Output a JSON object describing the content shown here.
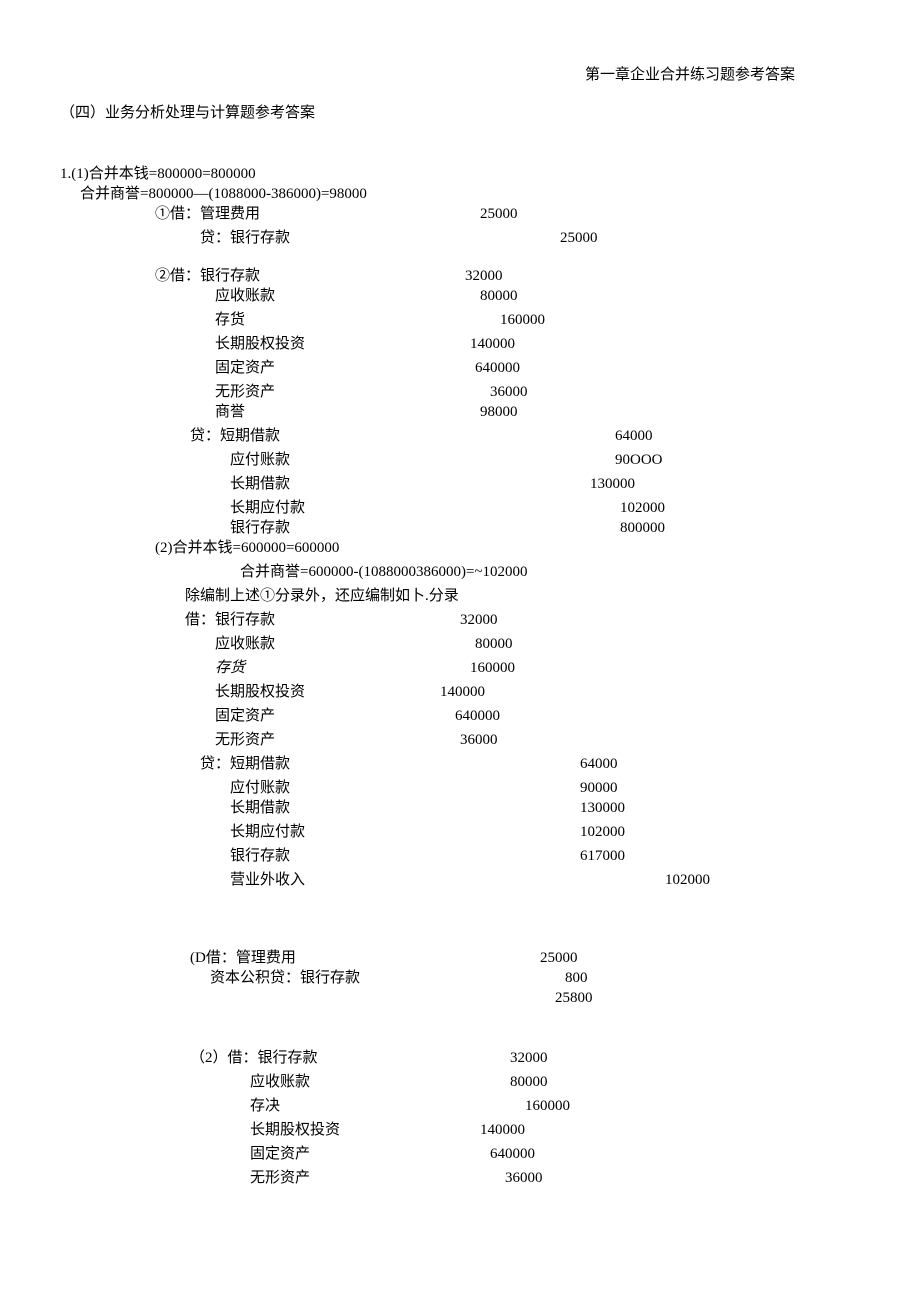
{
  "header": "第一章企业合并练习题参考答案",
  "section": "（四）业务分析处理与计算题参考答案",
  "p1": {
    "l1": "1.(1)合并本钱=800000=800000",
    "l2": "合并商誉=800000—(1088000-386000)=98000",
    "e1_label": "①借：管理费用",
    "e1_val": "25000",
    "e1c_label": "贷：银行存款",
    "e1c_val": "25000",
    "e2_label": "②借：银行存款",
    "e2_val": "32000",
    "e2a_label": "应收账款",
    "e2a_val": "80000",
    "e2b_label": "存货",
    "e2b_val": "160000",
    "e2c_label": "长期股权投资",
    "e2c_val": "140000",
    "e2d_label": "固定资产",
    "e2d_val": "640000",
    "e2e_label": "无形资产",
    "e2e_val": "36000",
    "e2f_label": "商誉",
    "e2f_val": "98000",
    "e2g_label": "贷：短期借款",
    "e2g_val": "64000",
    "e2h_label": "应付账款",
    "e2h_val": "90OOO",
    "e2i_label": "长期借款",
    "e2i_val": "130000",
    "e2j_label": "长期应付款",
    "e2j_val": "102000",
    "e2k_label": "银行存款",
    "e2k_val": "800000"
  },
  "p2": {
    "l1": "(2)合并本钱=600000=600000",
    "l2": "合并商誉=600000-(1088000386000)=~102000",
    "l3": "除编制上述①分录外，还应编制如卜.分录",
    "e1_label": "借：银行存款",
    "e1_val": "32000",
    "e2_label": "应收账款",
    "e2_val": "80000",
    "e3_label": "存货",
    "e3_val": "160000",
    "e4_label": "长期股权投资",
    "e4_val": "140000",
    "e5_label": "固定资产",
    "e5_val": "640000",
    "e6_label": "无形资产",
    "e6_val": "36000",
    "e7_label": "贷：短期借款",
    "e7_val": "64000",
    "e8_label": "应付账款",
    "e8_val": "90000",
    "e9_label": "长期借款",
    "e9_val": "130000",
    "e10_label": "长期应付款",
    "e10_val": "102000",
    "e11_label": "银行存款",
    "e11_val": "617000",
    "e12_label": "营业外收入",
    "e12_val": "102000"
  },
  "pD": {
    "l1_label": "(D借：管理费用",
    "l1_val": "25000",
    "l2_label": "资本公积贷：银行存款",
    "l2_val": "800",
    "l3_val": "25800"
  },
  "p2b": {
    "l1_label": "（2）借：银行存款",
    "l1_val": "32000",
    "l2_label": "应收账款",
    "l2_val": "80000",
    "l3_label": "存决",
    "l3_val": "160000",
    "l4_label": "长期股权投资",
    "l4_val": "140000",
    "l5_label": "固定资产",
    "l5_val": "640000",
    "l6_label": "无形资产",
    "l6_val": "36000"
  }
}
